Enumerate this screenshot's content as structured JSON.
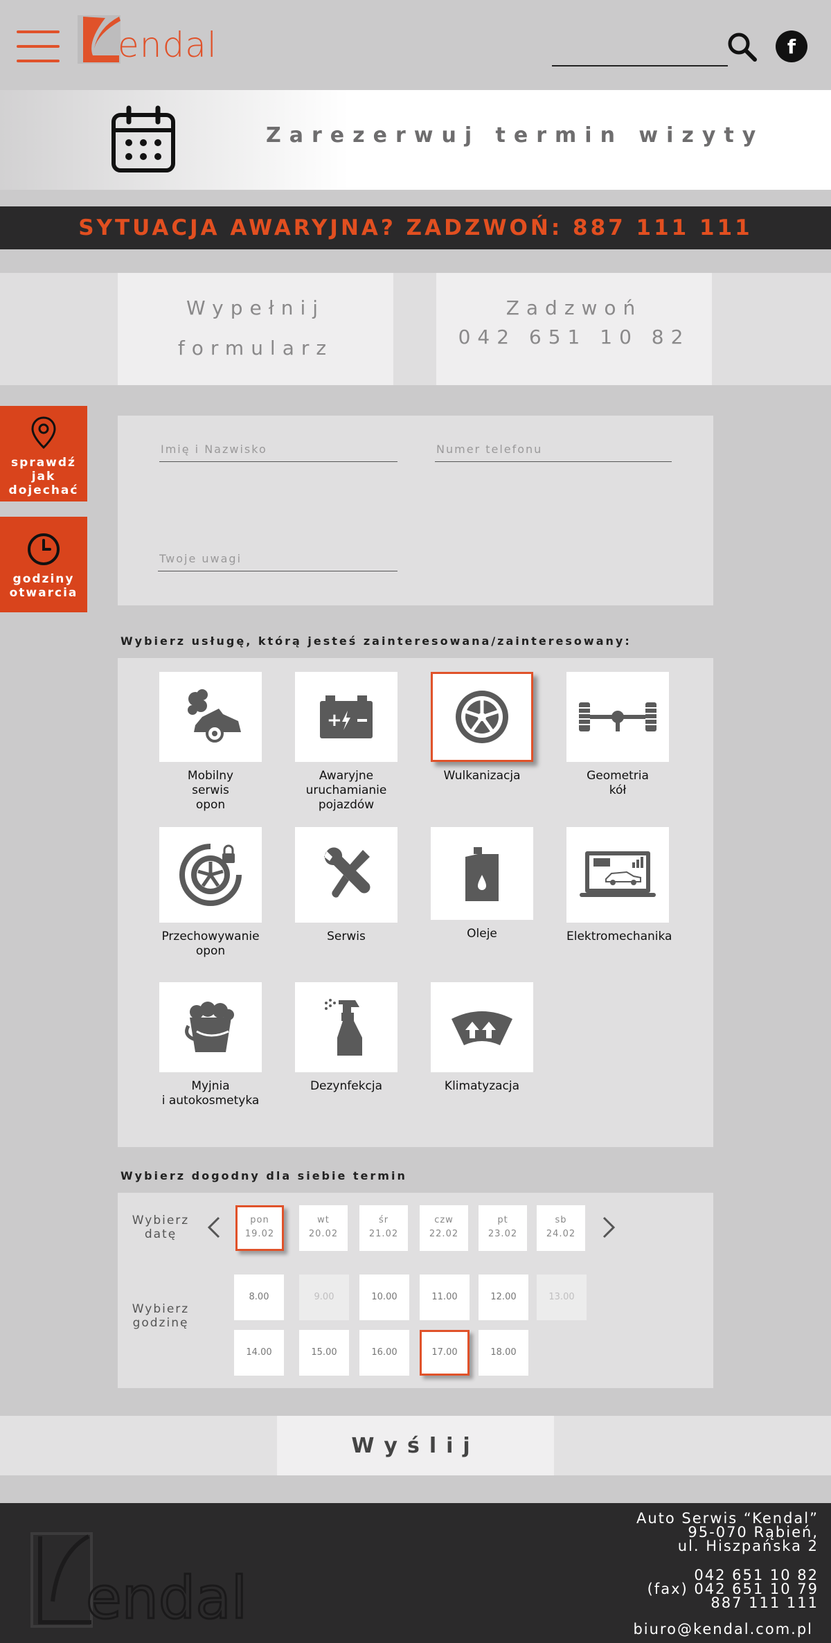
{
  "header": {
    "logo_text": "endal",
    "search_placeholder": "",
    "facebook_label": "f"
  },
  "banner": {
    "title": "Zarezerwuj termin wizyty"
  },
  "emergency": {
    "text": "SYTUACJA AWARYJNA?  ZADZWOŃ: 887 111 111"
  },
  "modes": {
    "form_line1": "Wypełnij",
    "form_line2": "formularz",
    "call_line1": "Zadzwoń",
    "call_line2": "042 651 10 82"
  },
  "side": {
    "directions": [
      "sprawdź",
      "jak",
      "dojechać"
    ],
    "hours": [
      "godziny",
      "otwarcia"
    ]
  },
  "form": {
    "name_placeholder": "Imię i Nazwisko",
    "phone_placeholder": "Numer telefonu",
    "notes_placeholder": "Twoje uwagi"
  },
  "services_label": "Wybierz usługę, którą jesteś zainteresowana/zainteresowany:",
  "services": [
    {
      "label": "Mobilny\nserwis\nopon",
      "icon": "mobile-service-icon"
    },
    {
      "label": "Awaryjne\nuruchamianie\npojazdów",
      "icon": "battery-icon"
    },
    {
      "label": "Wulkanizacja",
      "icon": "wheel-icon",
      "selected": true
    },
    {
      "label": "Geometria\nkół",
      "icon": "axle-icon"
    },
    {
      "label": "Przechowywanie\nopon",
      "icon": "tire-storage-icon"
    },
    {
      "label": "Serwis",
      "icon": "tools-icon"
    },
    {
      "label": "Oleje",
      "icon": "oil-can-icon"
    },
    {
      "label": "Elektromechanika",
      "icon": "laptop-car-icon"
    },
    {
      "label": "Myjnia\ni autokosmetyka",
      "icon": "bucket-icon"
    },
    {
      "label": "Dezynfekcja",
      "icon": "spray-bottle-icon"
    },
    {
      "label": "Klimatyzacja",
      "icon": "windshield-icon"
    }
  ],
  "date_label": "Wybierz dogodny dla siebie termin",
  "date_row_label": [
    "Wybierz",
    "datę"
  ],
  "hour_row_label": [
    "Wybierz",
    "godzinę"
  ],
  "days": [
    {
      "name": "pon",
      "date": "19.02",
      "selected": true
    },
    {
      "name": "wt",
      "date": "20.02"
    },
    {
      "name": "śr",
      "date": "21.02"
    },
    {
      "name": "czw",
      "date": "22.02"
    },
    {
      "name": "pt",
      "date": "23.02"
    },
    {
      "name": "sb",
      "date": "24.02"
    }
  ],
  "hours_row1": [
    {
      "t": "8.00"
    },
    {
      "t": "9.00",
      "disabled": true
    },
    {
      "t": "10.00"
    },
    {
      "t": "11.00"
    },
    {
      "t": "12.00"
    },
    {
      "t": "13.00",
      "disabled": true
    }
  ],
  "hours_row2": [
    {
      "t": "14.00"
    },
    {
      "t": "15.00"
    },
    {
      "t": "16.00"
    },
    {
      "t": "17.00",
      "selected": true
    },
    {
      "t": "18.00"
    }
  ],
  "submit_label": "Wyślij",
  "footer": {
    "address": [
      "Auto Serwis “Kendal”",
      "95-070 Rąbień,",
      "ul. Hiszpańska 2"
    ],
    "phones": [
      "042 651 10 82",
      "(fax) 042 651 10 79",
      "887 111 111"
    ],
    "email": "biuro@kendal.com.pl",
    "logo_text": "endal"
  },
  "colors": {
    "accent": "#e0522a",
    "dark": "#2a292a",
    "bg": "#cbcacb"
  }
}
